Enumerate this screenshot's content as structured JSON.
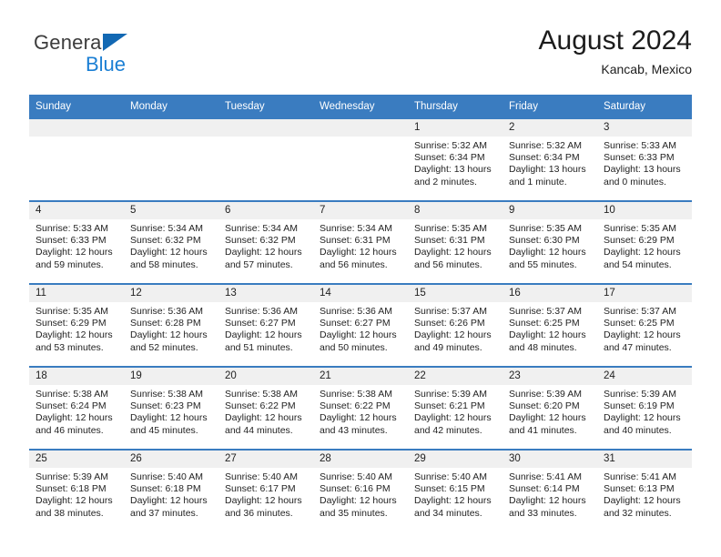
{
  "brand": {
    "name_part1": "General",
    "name_part2": "Blue",
    "triangle_color": "#1268b3",
    "blue_color": "#1b7fd4"
  },
  "header": {
    "title": "August 2024",
    "subtitle": "Kancab, Mexico"
  },
  "theme": {
    "header_bg": "#3a7cc0",
    "header_text": "#ffffff",
    "daynum_band_bg": "#f0f0f0",
    "cell_bg": "#ffffff",
    "row_border": "#3a7cc0"
  },
  "weekday_headers": [
    "Sunday",
    "Monday",
    "Tuesday",
    "Wednesday",
    "Thursday",
    "Friday",
    "Saturday"
  ],
  "weeks": [
    [
      {
        "day": "",
        "empty": true,
        "sunrise": "",
        "sunset": "",
        "daylight_line1": "",
        "daylight_line2": ""
      },
      {
        "day": "",
        "empty": true,
        "sunrise": "",
        "sunset": "",
        "daylight_line1": "",
        "daylight_line2": ""
      },
      {
        "day": "",
        "empty": true,
        "sunrise": "",
        "sunset": "",
        "daylight_line1": "",
        "daylight_line2": ""
      },
      {
        "day": "",
        "empty": true,
        "sunrise": "",
        "sunset": "",
        "daylight_line1": "",
        "daylight_line2": ""
      },
      {
        "day": "1",
        "empty": false,
        "sunrise": "Sunrise: 5:32 AM",
        "sunset": "Sunset: 6:34 PM",
        "daylight_line1": "Daylight: 13 hours",
        "daylight_line2": "and 2 minutes."
      },
      {
        "day": "2",
        "empty": false,
        "sunrise": "Sunrise: 5:32 AM",
        "sunset": "Sunset: 6:34 PM",
        "daylight_line1": "Daylight: 13 hours",
        "daylight_line2": "and 1 minute."
      },
      {
        "day": "3",
        "empty": false,
        "sunrise": "Sunrise: 5:33 AM",
        "sunset": "Sunset: 6:33 PM",
        "daylight_line1": "Daylight: 13 hours",
        "daylight_line2": "and 0 minutes."
      }
    ],
    [
      {
        "day": "4",
        "empty": false,
        "sunrise": "Sunrise: 5:33 AM",
        "sunset": "Sunset: 6:33 PM",
        "daylight_line1": "Daylight: 12 hours",
        "daylight_line2": "and 59 minutes."
      },
      {
        "day": "5",
        "empty": false,
        "sunrise": "Sunrise: 5:34 AM",
        "sunset": "Sunset: 6:32 PM",
        "daylight_line1": "Daylight: 12 hours",
        "daylight_line2": "and 58 minutes."
      },
      {
        "day": "6",
        "empty": false,
        "sunrise": "Sunrise: 5:34 AM",
        "sunset": "Sunset: 6:32 PM",
        "daylight_line1": "Daylight: 12 hours",
        "daylight_line2": "and 57 minutes."
      },
      {
        "day": "7",
        "empty": false,
        "sunrise": "Sunrise: 5:34 AM",
        "sunset": "Sunset: 6:31 PM",
        "daylight_line1": "Daylight: 12 hours",
        "daylight_line2": "and 56 minutes."
      },
      {
        "day": "8",
        "empty": false,
        "sunrise": "Sunrise: 5:35 AM",
        "sunset": "Sunset: 6:31 PM",
        "daylight_line1": "Daylight: 12 hours",
        "daylight_line2": "and 56 minutes."
      },
      {
        "day": "9",
        "empty": false,
        "sunrise": "Sunrise: 5:35 AM",
        "sunset": "Sunset: 6:30 PM",
        "daylight_line1": "Daylight: 12 hours",
        "daylight_line2": "and 55 minutes."
      },
      {
        "day": "10",
        "empty": false,
        "sunrise": "Sunrise: 5:35 AM",
        "sunset": "Sunset: 6:29 PM",
        "daylight_line1": "Daylight: 12 hours",
        "daylight_line2": "and 54 minutes."
      }
    ],
    [
      {
        "day": "11",
        "empty": false,
        "sunrise": "Sunrise: 5:35 AM",
        "sunset": "Sunset: 6:29 PM",
        "daylight_line1": "Daylight: 12 hours",
        "daylight_line2": "and 53 minutes."
      },
      {
        "day": "12",
        "empty": false,
        "sunrise": "Sunrise: 5:36 AM",
        "sunset": "Sunset: 6:28 PM",
        "daylight_line1": "Daylight: 12 hours",
        "daylight_line2": "and 52 minutes."
      },
      {
        "day": "13",
        "empty": false,
        "sunrise": "Sunrise: 5:36 AM",
        "sunset": "Sunset: 6:27 PM",
        "daylight_line1": "Daylight: 12 hours",
        "daylight_line2": "and 51 minutes."
      },
      {
        "day": "14",
        "empty": false,
        "sunrise": "Sunrise: 5:36 AM",
        "sunset": "Sunset: 6:27 PM",
        "daylight_line1": "Daylight: 12 hours",
        "daylight_line2": "and 50 minutes."
      },
      {
        "day": "15",
        "empty": false,
        "sunrise": "Sunrise: 5:37 AM",
        "sunset": "Sunset: 6:26 PM",
        "daylight_line1": "Daylight: 12 hours",
        "daylight_line2": "and 49 minutes."
      },
      {
        "day": "16",
        "empty": false,
        "sunrise": "Sunrise: 5:37 AM",
        "sunset": "Sunset: 6:25 PM",
        "daylight_line1": "Daylight: 12 hours",
        "daylight_line2": "and 48 minutes."
      },
      {
        "day": "17",
        "empty": false,
        "sunrise": "Sunrise: 5:37 AM",
        "sunset": "Sunset: 6:25 PM",
        "daylight_line1": "Daylight: 12 hours",
        "daylight_line2": "and 47 minutes."
      }
    ],
    [
      {
        "day": "18",
        "empty": false,
        "sunrise": "Sunrise: 5:38 AM",
        "sunset": "Sunset: 6:24 PM",
        "daylight_line1": "Daylight: 12 hours",
        "daylight_line2": "and 46 minutes."
      },
      {
        "day": "19",
        "empty": false,
        "sunrise": "Sunrise: 5:38 AM",
        "sunset": "Sunset: 6:23 PM",
        "daylight_line1": "Daylight: 12 hours",
        "daylight_line2": "and 45 minutes."
      },
      {
        "day": "20",
        "empty": false,
        "sunrise": "Sunrise: 5:38 AM",
        "sunset": "Sunset: 6:22 PM",
        "daylight_line1": "Daylight: 12 hours",
        "daylight_line2": "and 44 minutes."
      },
      {
        "day": "21",
        "empty": false,
        "sunrise": "Sunrise: 5:38 AM",
        "sunset": "Sunset: 6:22 PM",
        "daylight_line1": "Daylight: 12 hours",
        "daylight_line2": "and 43 minutes."
      },
      {
        "day": "22",
        "empty": false,
        "sunrise": "Sunrise: 5:39 AM",
        "sunset": "Sunset: 6:21 PM",
        "daylight_line1": "Daylight: 12 hours",
        "daylight_line2": "and 42 minutes."
      },
      {
        "day": "23",
        "empty": false,
        "sunrise": "Sunrise: 5:39 AM",
        "sunset": "Sunset: 6:20 PM",
        "daylight_line1": "Daylight: 12 hours",
        "daylight_line2": "and 41 minutes."
      },
      {
        "day": "24",
        "empty": false,
        "sunrise": "Sunrise: 5:39 AM",
        "sunset": "Sunset: 6:19 PM",
        "daylight_line1": "Daylight: 12 hours",
        "daylight_line2": "and 40 minutes."
      }
    ],
    [
      {
        "day": "25",
        "empty": false,
        "sunrise": "Sunrise: 5:39 AM",
        "sunset": "Sunset: 6:18 PM",
        "daylight_line1": "Daylight: 12 hours",
        "daylight_line2": "and 38 minutes."
      },
      {
        "day": "26",
        "empty": false,
        "sunrise": "Sunrise: 5:40 AM",
        "sunset": "Sunset: 6:18 PM",
        "daylight_line1": "Daylight: 12 hours",
        "daylight_line2": "and 37 minutes."
      },
      {
        "day": "27",
        "empty": false,
        "sunrise": "Sunrise: 5:40 AM",
        "sunset": "Sunset: 6:17 PM",
        "daylight_line1": "Daylight: 12 hours",
        "daylight_line2": "and 36 minutes."
      },
      {
        "day": "28",
        "empty": false,
        "sunrise": "Sunrise: 5:40 AM",
        "sunset": "Sunset: 6:16 PM",
        "daylight_line1": "Daylight: 12 hours",
        "daylight_line2": "and 35 minutes."
      },
      {
        "day": "29",
        "empty": false,
        "sunrise": "Sunrise: 5:40 AM",
        "sunset": "Sunset: 6:15 PM",
        "daylight_line1": "Daylight: 12 hours",
        "daylight_line2": "and 34 minutes."
      },
      {
        "day": "30",
        "empty": false,
        "sunrise": "Sunrise: 5:41 AM",
        "sunset": "Sunset: 6:14 PM",
        "daylight_line1": "Daylight: 12 hours",
        "daylight_line2": "and 33 minutes."
      },
      {
        "day": "31",
        "empty": false,
        "sunrise": "Sunrise: 5:41 AM",
        "sunset": "Sunset: 6:13 PM",
        "daylight_line1": "Daylight: 12 hours",
        "daylight_line2": "and 32 minutes."
      }
    ]
  ]
}
